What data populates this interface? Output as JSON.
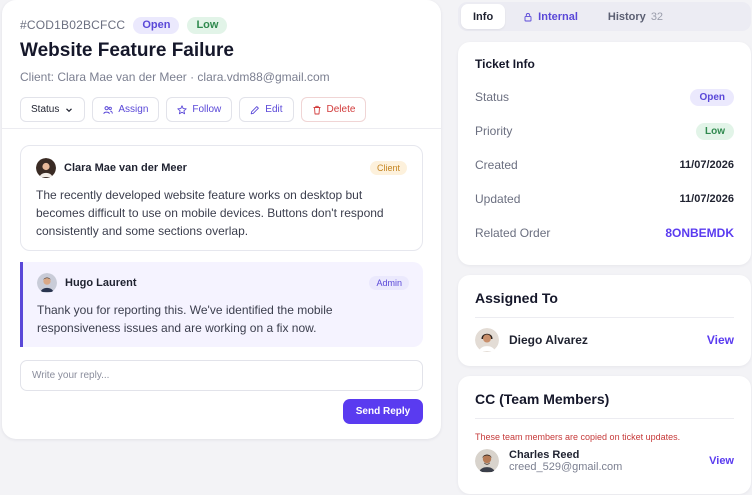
{
  "ticket": {
    "id": "#COD1B02BCFCC",
    "status_badge": "Open",
    "priority_badge": "Low",
    "title": "Website Feature Failure",
    "client_line": "Client: Clara Mae van der Meer · clara.vdm88@gmail.com",
    "actions": {
      "status": "Status",
      "assign": "Assign",
      "follow": "Follow",
      "edit": "Edit",
      "delete": "Delete"
    }
  },
  "messages": [
    {
      "author": "Clara Mae van der Meer",
      "role": "Client",
      "body": "The recently developed website feature works on desktop but becomes difficult to use on mobile devices. Buttons don't respond consistently and some sections overlap."
    },
    {
      "author": "Hugo Laurent",
      "role": "Admin",
      "body": "Thank you for reporting this. We've identified the mobile responsiveness issues and are working on a fix now."
    }
  ],
  "reply": {
    "placeholder": "Write your reply...",
    "send_label": "Send Reply"
  },
  "tabs": {
    "info": "Info",
    "internal": "Internal",
    "history": "History",
    "history_count": "32"
  },
  "ticket_info": {
    "title": "Ticket Info",
    "status_label": "Status",
    "status_value": "Open",
    "priority_label": "Priority",
    "priority_value": "Low",
    "created_label": "Created",
    "created_value": "11/07/2026",
    "updated_label": "Updated",
    "updated_value": "11/07/2026",
    "order_label": "Related Order",
    "order_value": "8ONBEMDK"
  },
  "assigned": {
    "title": "Assigned To",
    "name": "Diego Alvarez",
    "view": "View"
  },
  "cc": {
    "title": "CC (Team Members)",
    "note": "These team members are copied on ticket updates.",
    "name": "Charles Reed",
    "email": "creed_529@gmail.com",
    "view": "View"
  },
  "colors": {
    "accent": "#5a3bf0",
    "open_badge_bg": "#ebe9fd",
    "low_badge_bg": "#e2f4e8",
    "delete": "#d23b3b"
  }
}
